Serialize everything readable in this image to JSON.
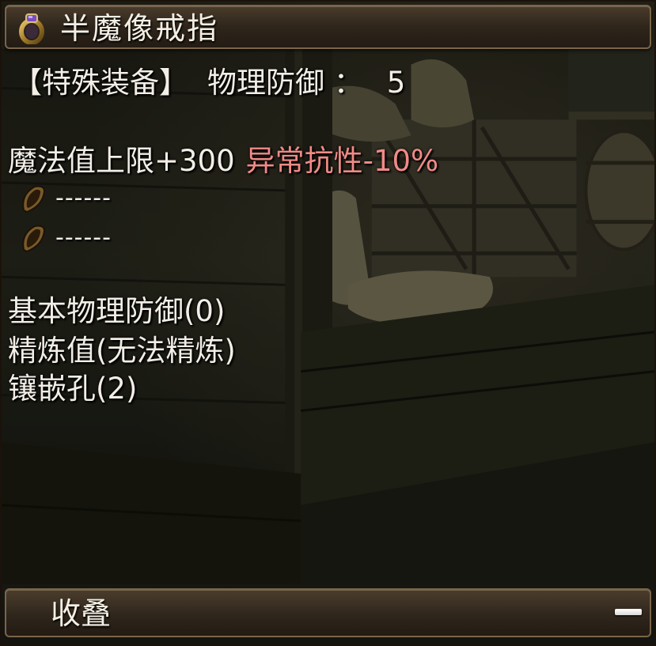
{
  "item": {
    "name": "半魔像戒指",
    "icon": "ring-icon"
  },
  "type_line": {
    "category": "【特殊装备】",
    "stat_label": "物理防御",
    "separator": "：",
    "stat_value": "5"
  },
  "attributes": {
    "bonus": "魔法值上限+300",
    "special": "异常抗性-10%",
    "special_color": "#f08a86"
  },
  "sockets": [
    {
      "icon": "gem-socket-icon",
      "value": "------"
    },
    {
      "icon": "gem-socket-icon",
      "value": "------"
    }
  ],
  "details": {
    "base_defense": "基本物理防御(0)",
    "refine": "精炼值(无法精炼)",
    "holes": "镶嵌孔(2)"
  },
  "footer": {
    "collapse_label": "收叠",
    "collapse_icon": "minus-icon"
  }
}
